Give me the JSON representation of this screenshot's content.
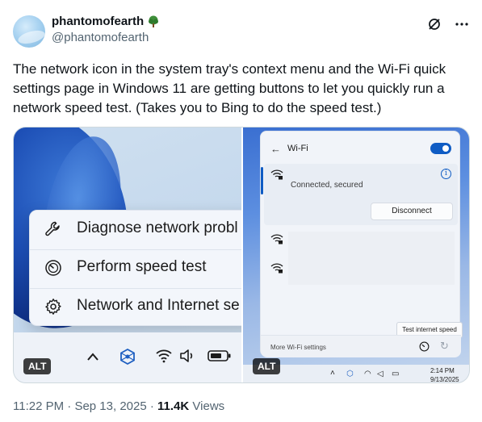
{
  "author": {
    "display_name": "phantomofearth",
    "handle": "@phantomofearth",
    "badge_icon": "tree-icon"
  },
  "header_actions": {
    "grok_icon": "slash-circle-icon",
    "more_icon": "more-horizontal-icon"
  },
  "tweet": {
    "text": "The network icon in the system tray's context menu and the Wi-Fi quick settings page in Windows 11 are getting buttons to let you quickly run a network speed test. (Takes you to Bing to do the speed test.)"
  },
  "media_left": {
    "menu_items": [
      {
        "label": "Diagnose network probl",
        "icon": "wrench-icon"
      },
      {
        "label": "Perform speed test",
        "icon": "gauge-icon"
      },
      {
        "label": "Network and Internet se",
        "icon": "gear-icon"
      }
    ],
    "alt_label": "ALT"
  },
  "media_right": {
    "wifi_title": "Wi-Fi",
    "connection_status": "Connected, secured",
    "disconnect_label": "Disconnect",
    "tooltip": "Test internet speed",
    "more_settings": "More Wi-Fi settings",
    "time": "2:14 PM",
    "date": "9/13/2025",
    "alt_label": "ALT",
    "toggle_on": true
  },
  "meta": {
    "time": "11:22 PM",
    "separator": "·",
    "date": "Sep 13, 2025",
    "views_count": "11.4K",
    "views_label": "Views"
  },
  "colors": {
    "accent": "#0f5cc4",
    "text": "#0f1419",
    "muted": "#536471"
  }
}
